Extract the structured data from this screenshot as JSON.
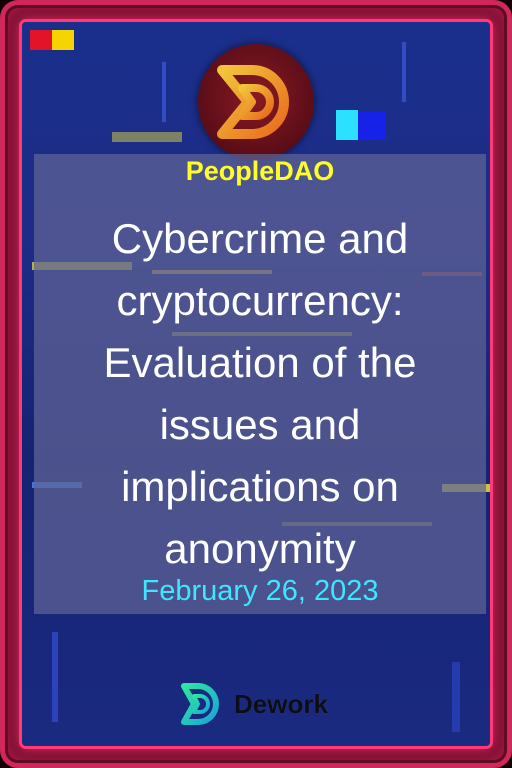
{
  "card": {
    "org_name": "PeopleDAO",
    "title": "Cybercrime and cryptocurrency: Evaluation of the issues and implications on anonymity",
    "date": "February 26, 2023"
  },
  "footer": {
    "platform_name": "Dework"
  },
  "icons": {
    "top_logo": "peopledao-logo-icon",
    "footer_logo": "dework-logo-icon"
  },
  "colors": {
    "frame": "#d0285a",
    "background": "#1d2c86",
    "org_name": "#ffff26",
    "title": "#ffffff",
    "date": "#3ee6ff"
  }
}
